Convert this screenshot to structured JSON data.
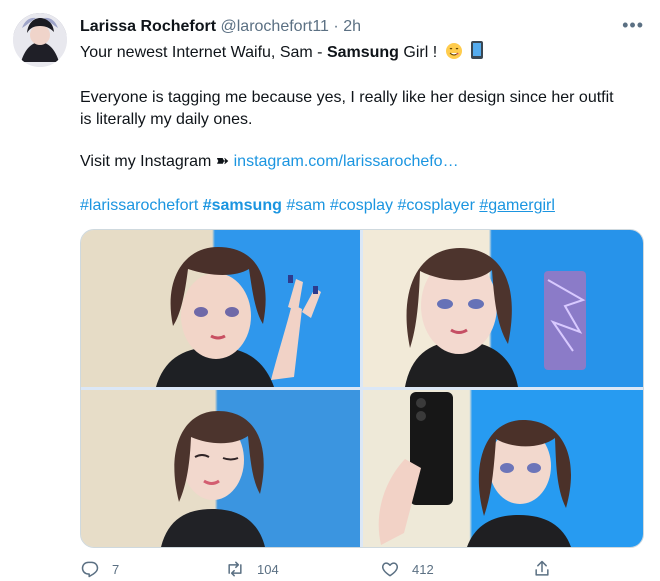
{
  "tweet": {
    "display_name": "Larissa Rochefort",
    "handle": "@larochefort11",
    "separator": "·",
    "time": "2h",
    "more_icon": "more-horizontal-icon",
    "text": {
      "line1_a": "Your newest Internet Waifu, Sam - ",
      "line1_bold": "Samsung",
      "line1_b": " Girl !",
      "line2": "Everyone is tagging me because yes, I really like her design since her outfit",
      "line3": "is literally my daily ones.",
      "line4_prefix": "Visit my Instagram ",
      "line4_arrow": "➽",
      "link": "instagram.com/larissarochefo…"
    },
    "hashtags": [
      {
        "text": "#larissarochefort",
        "bold": false
      },
      {
        "text": "#samsung",
        "bold": true
      },
      {
        "text": "#sam",
        "bold": false
      },
      {
        "text": "#cosplay",
        "bold": false
      },
      {
        "text": "#cosplayer",
        "bold": false
      },
      {
        "text": "#gamergirl",
        "bold": false
      }
    ],
    "images": [
      {
        "alt": "cosplayer peace sign"
      },
      {
        "alt": "cosplayer holding smartphone"
      },
      {
        "alt": "cosplayer winking"
      },
      {
        "alt": "cosplayer holding black phone"
      }
    ],
    "actions": {
      "reply_count": "7",
      "retweet_count": "104",
      "like_count": "412"
    }
  },
  "colors": {
    "link": "#1b95e0",
    "muted": "#5b7083"
  }
}
